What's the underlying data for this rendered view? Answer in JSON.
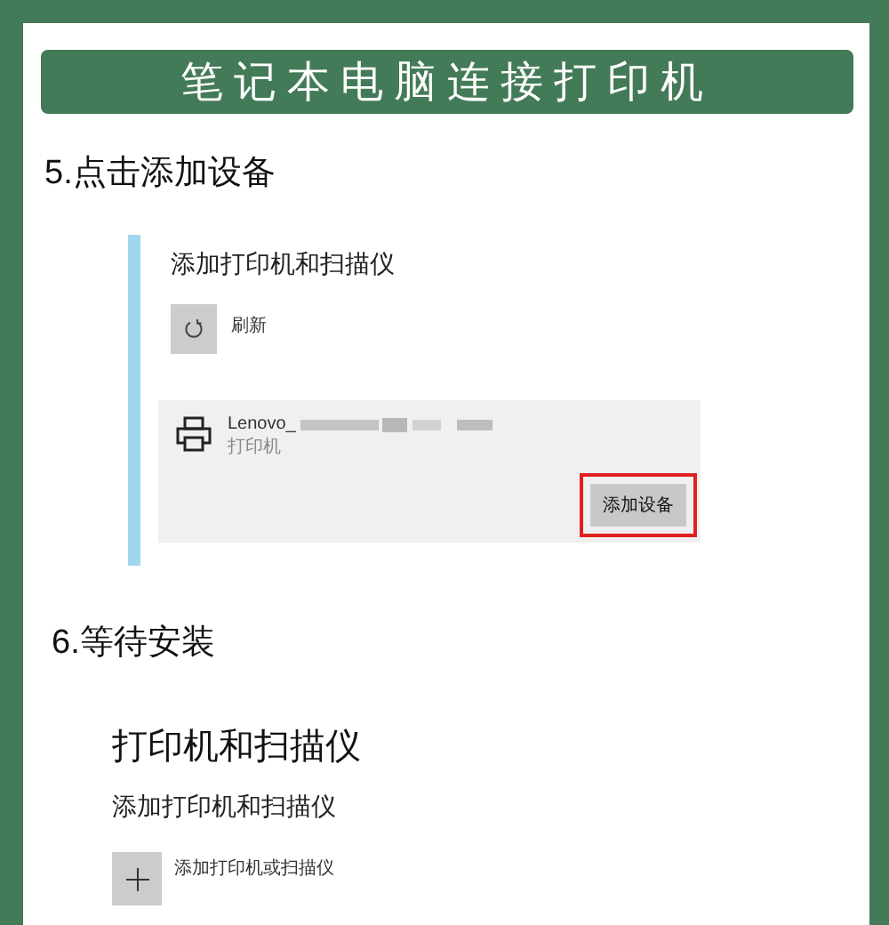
{
  "banner": {
    "title": "笔记本电脑连接打印机"
  },
  "step5": {
    "heading": "5.点击添加设备",
    "panel_title": "添加打印机和扫描仪",
    "refresh_label": "刷新",
    "device": {
      "name": "Lenovo_",
      "type": "打印机",
      "redacted": true
    },
    "add_button": {
      "label": "添加设备",
      "highlighted": true
    }
  },
  "step6": {
    "heading": "6.等待安装",
    "page_title": "打印机和扫描仪",
    "section_title": "添加打印机和扫描仪",
    "add_item_label": "添加打印机或扫描仪"
  }
}
